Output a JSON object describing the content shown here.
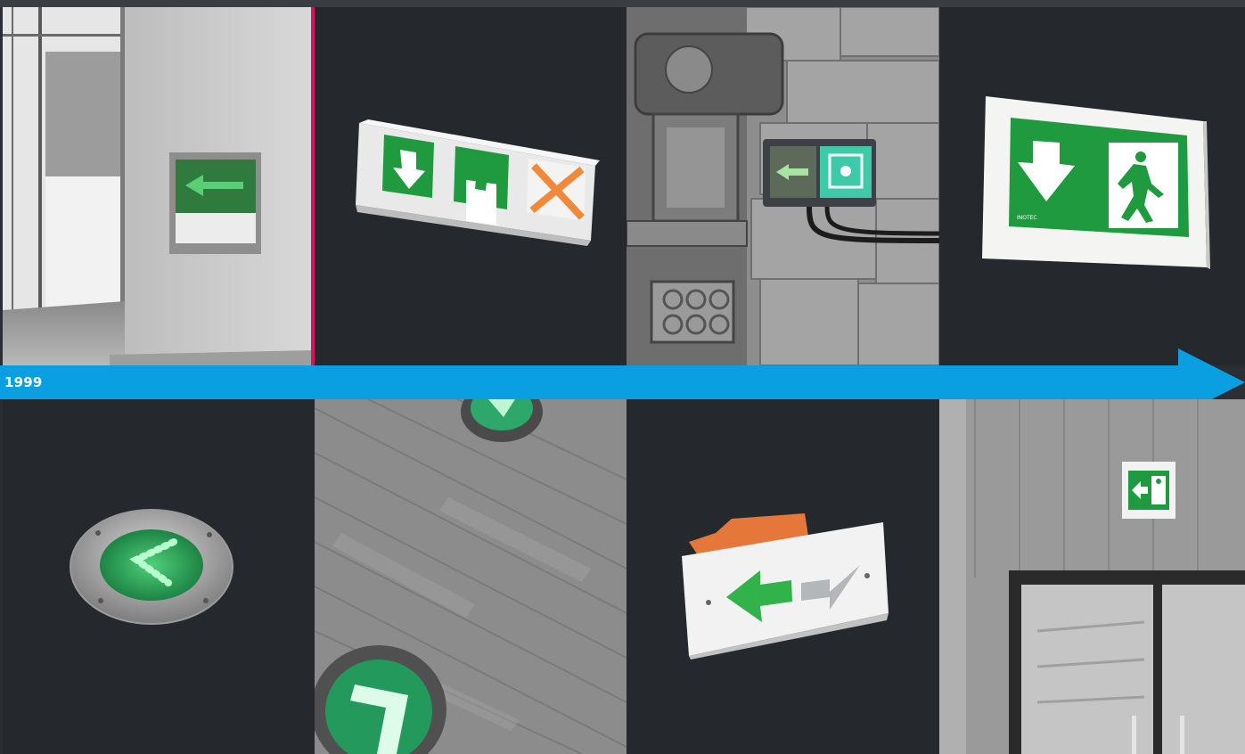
{
  "timeline": {
    "year": "1999",
    "accent_color": "#0a9fe0",
    "divider_color": "#d4145a"
  },
  "tiles": [
    {
      "name": "recessed-wall-exit-sign"
    },
    {
      "name": "triple-symbol-exit-sign"
    },
    {
      "name": "stone-wall-assembly-sign"
    },
    {
      "name": "framed-running-man-sign"
    },
    {
      "name": "round-floor-arrow-light"
    },
    {
      "name": "wooden-floor-arrow-lights"
    },
    {
      "name": "double-arrow-plate-sign"
    },
    {
      "name": "doorway-exit-sign"
    }
  ],
  "sign_labels": {
    "brand_mark": "INOTEC"
  }
}
